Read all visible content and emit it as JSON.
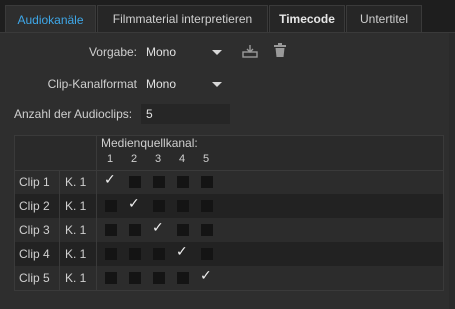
{
  "tabs": [
    {
      "label": "Audiokanäle",
      "active": true
    },
    {
      "label": "Filmmaterial interpretieren",
      "active": false
    },
    {
      "label": "Timecode",
      "active": false
    },
    {
      "label": "Untertitel",
      "active": false
    }
  ],
  "form": {
    "preset_label": "Vorgabe:",
    "preset_value": "Mono",
    "clip_format_label": "Clip-Kanalformat",
    "clip_format_value": "Mono",
    "audio_clips_label": "Anzahl der Audioclips:",
    "audio_clips_value": "5"
  },
  "icons": {
    "save_preset": "save-preset-icon",
    "delete_preset": "trash-icon"
  },
  "grid": {
    "header_label": "Medienquellkanal:",
    "channels": [
      "1",
      "2",
      "3",
      "4",
      "5"
    ],
    "rows": [
      {
        "clip": "Clip 1",
        "channel": "K. 1",
        "checked_index": 0
      },
      {
        "clip": "Clip 2",
        "channel": "K. 1",
        "checked_index": 1
      },
      {
        "clip": "Clip 3",
        "channel": "K. 1",
        "checked_index": 2
      },
      {
        "clip": "Clip 4",
        "channel": "K. 1",
        "checked_index": 3
      },
      {
        "clip": "Clip 5",
        "channel": "K. 1",
        "checked_index": 4
      }
    ]
  },
  "colors": {
    "accent": "#3ea7e8",
    "panel": "#2e2e2e",
    "background": "#1e1e1e"
  }
}
